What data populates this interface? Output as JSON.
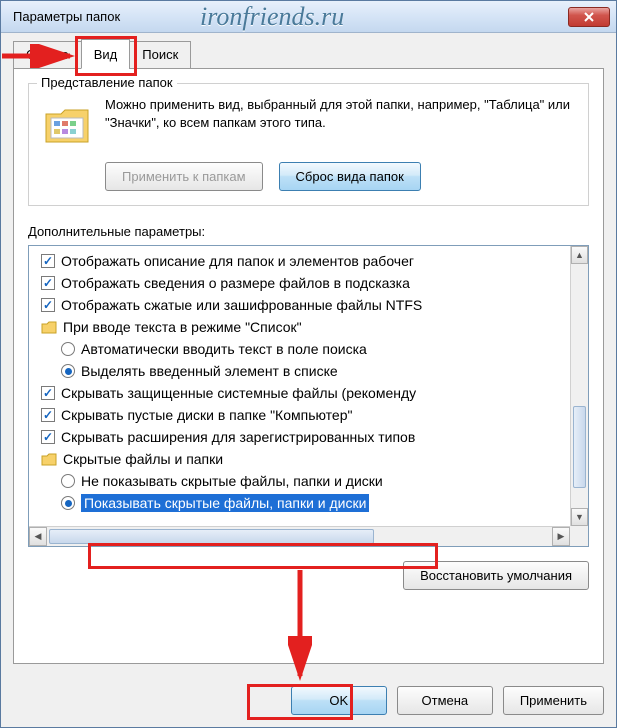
{
  "window": {
    "title": "Параметры папок",
    "watermark": "ironfriends.ru"
  },
  "tabs": {
    "general": "Общие",
    "view": "Вид",
    "search": "Поиск"
  },
  "group": {
    "legend": "Представление папок",
    "description": "Можно применить вид, выбранный для этой папки, например, \"Таблица\" или \"Значки\", ко всем папкам этого типа.",
    "apply_btn": "Применить к папкам",
    "reset_btn": "Сброс вида папок"
  },
  "advanced": {
    "label": "Дополнительные параметры:",
    "items": {
      "desc_tips": "Отображать описание для папок и элементов рабочег",
      "size_tips": "Отображать сведения о размере файлов в подсказка",
      "ntfs_color": "Отображать сжатые или зашифрованные файлы NTFS",
      "list_typing_group": "При вводе текста в режиме \"Список\"",
      "list_typing_search": "Автоматически вводить текст в поле поиска",
      "list_typing_select": "Выделять введенный элемент в списке",
      "hide_protected": "Скрывать защищенные системные файлы (рекоменду",
      "hide_empty_drives": "Скрывать пустые диски в папке \"Компьютер\"",
      "hide_extensions": "Скрывать расширения для зарегистрированных типов",
      "hidden_group": "Скрытые файлы и папки",
      "hidden_dont_show": "Не показывать скрытые файлы, папки и диски",
      "hidden_show": "Показывать скрытые файлы, папки и диски"
    }
  },
  "buttons": {
    "restore_defaults": "Восстановить умолчания",
    "ok": "OK",
    "cancel": "Отмена",
    "apply": "Применить"
  }
}
